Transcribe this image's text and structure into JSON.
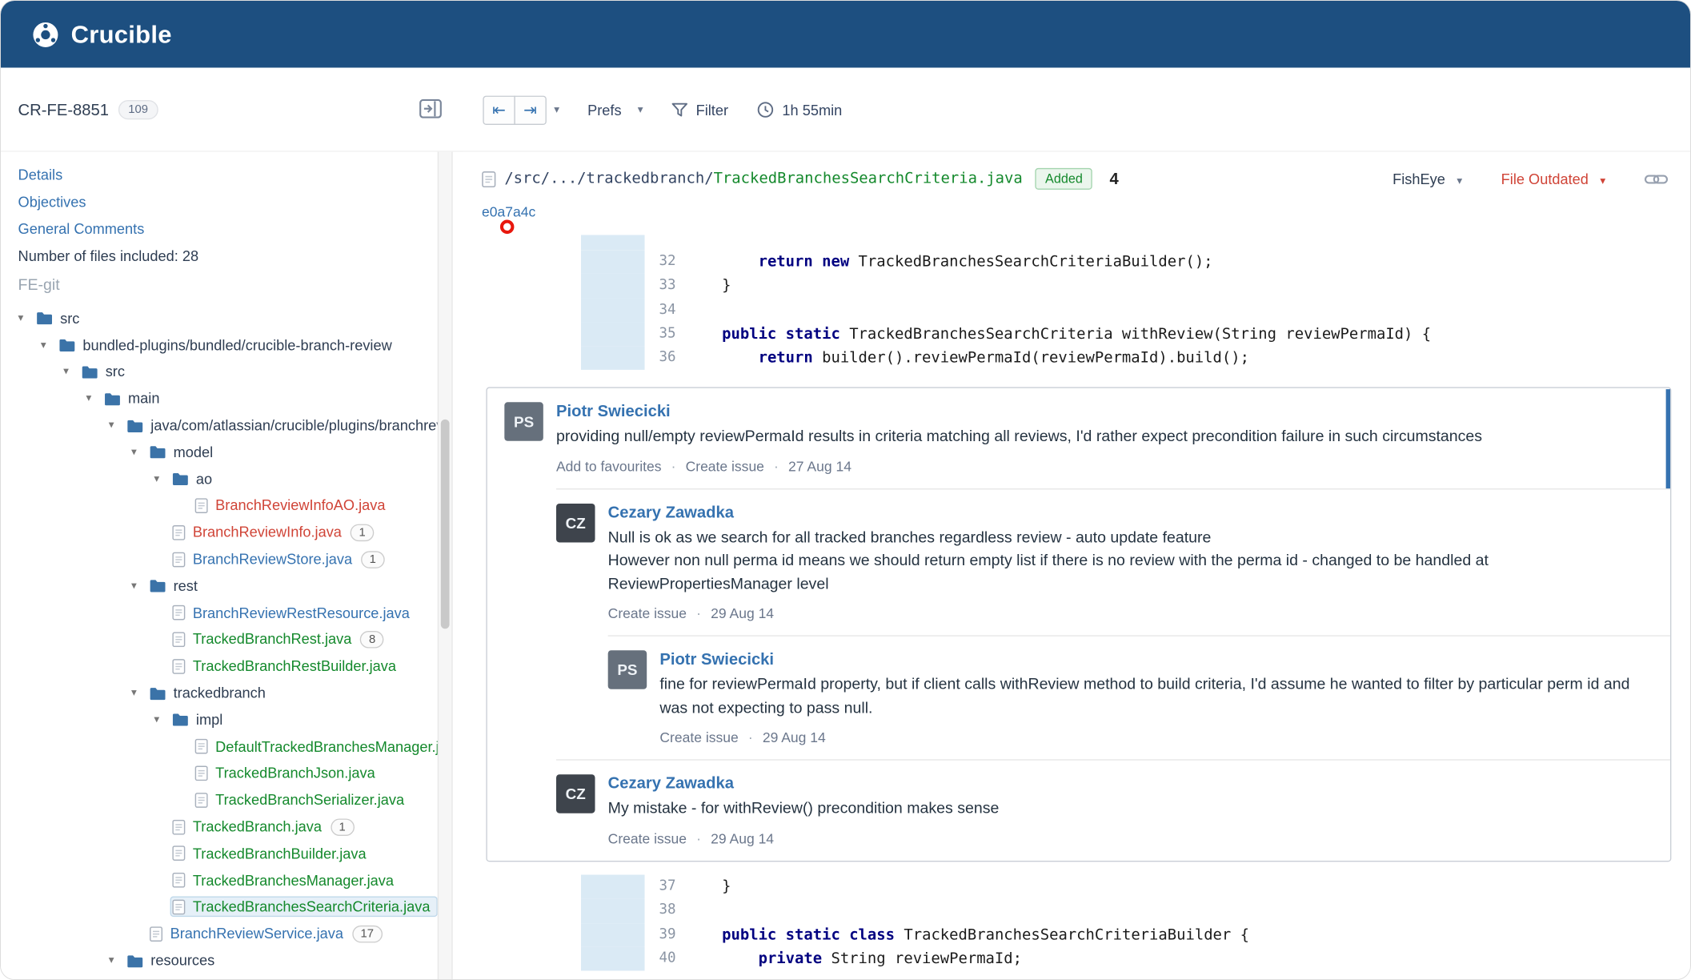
{
  "navbar": {
    "brand": "Crucible"
  },
  "colors": {
    "navbar": "#1d4f80",
    "accent_blue": "#3572b0",
    "added_green": "#14892c",
    "removed_red": "#d04437",
    "gutter_added": "#daeaf5",
    "keyword": "#000080"
  },
  "icons": {
    "prev_file": "⇤",
    "next_file": "⇥",
    "caret": "▾",
    "expanded_caret": "▾"
  },
  "misc": {
    "meta_separator": "·"
  },
  "left_panel": {
    "review_key": "CR-FE-8851",
    "review_count": "109",
    "links": [
      "Details",
      "Objectives",
      "General Comments"
    ],
    "files_included": "Number of files included: 28",
    "repo_label": "FE-git",
    "tree": [
      {
        "label": "src",
        "depth": 0,
        "kind": "folder"
      },
      {
        "label": "bundled-plugins/bundled/crucible-branch-review",
        "depth": 1,
        "kind": "folder"
      },
      {
        "label": "src",
        "depth": 2,
        "kind": "folder"
      },
      {
        "label": "main",
        "depth": 3,
        "kind": "folder"
      },
      {
        "label": "java/com/atlassian/crucible/plugins/branchreview",
        "depth": 4,
        "kind": "folder"
      },
      {
        "label": "model",
        "depth": 5,
        "kind": "folder"
      },
      {
        "label": "ao",
        "depth": 6,
        "kind": "folder"
      },
      {
        "label": "BranchReviewInfoAO.java",
        "depth": 7,
        "kind": "file",
        "color": "red"
      },
      {
        "label": "BranchReviewInfo.java",
        "depth": 6,
        "kind": "file",
        "color": "red",
        "badge": "1"
      },
      {
        "label": "BranchReviewStore.java",
        "depth": 6,
        "kind": "file",
        "color": "blue",
        "badge": "1"
      },
      {
        "label": "rest",
        "depth": 5,
        "kind": "folder"
      },
      {
        "label": "BranchReviewRestResource.java",
        "depth": 6,
        "kind": "file",
        "color": "blue"
      },
      {
        "label": "TrackedBranchRest.java",
        "depth": 6,
        "kind": "file",
        "color": "green",
        "badge": "8"
      },
      {
        "label": "TrackedBranchRestBuilder.java",
        "depth": 6,
        "kind": "file",
        "color": "green"
      },
      {
        "label": "trackedbranch",
        "depth": 5,
        "kind": "folder"
      },
      {
        "label": "impl",
        "depth": 6,
        "kind": "folder"
      },
      {
        "label": "DefaultTrackedBranchesManager.java",
        "depth": 7,
        "kind": "file",
        "color": "green"
      },
      {
        "label": "TrackedBranchJson.java",
        "depth": 7,
        "kind": "file",
        "color": "green"
      },
      {
        "label": "TrackedBranchSerializer.java",
        "depth": 7,
        "kind": "file",
        "color": "green"
      },
      {
        "label": "TrackedBranch.java",
        "depth": 6,
        "kind": "file",
        "color": "green",
        "badge": "1"
      },
      {
        "label": "TrackedBranchBuilder.java",
        "depth": 6,
        "kind": "file",
        "color": "green"
      },
      {
        "label": "TrackedBranchesManager.java",
        "depth": 6,
        "kind": "file",
        "color": "green"
      },
      {
        "label": "TrackedBranchesSearchCriteria.java",
        "depth": 6,
        "kind": "file",
        "color": "green",
        "selected": true
      },
      {
        "label": "BranchReviewService.java",
        "depth": 5,
        "kind": "file",
        "color": "blue",
        "badge": "17"
      },
      {
        "label": "resources",
        "depth": 4,
        "kind": "folder"
      }
    ]
  },
  "toolbar": {
    "prefs_label": "Prefs",
    "filter_label": "Filter",
    "time_label": "1h 55min"
  },
  "file_header": {
    "path_prefix": "/src/.../trackedbranch/",
    "file_name": "TrackedBranchesSearchCriteria.java",
    "status": "Added",
    "comment_count": "4",
    "fisheye_label": "FishEye",
    "outdated_label": "File Outdated",
    "revision": "e0a7a4c"
  },
  "code": {
    "blocks": [
      {
        "clipped_top": true,
        "lines": [
          {
            "no": "32",
            "parts": [
              {
                "t": "        "
              },
              {
                "t": "return",
                "k": 1
              },
              {
                "t": " "
              },
              {
                "t": "new",
                "k": 1
              },
              {
                "t": " TrackedBranchesSearchCriteriaBuilder();"
              }
            ]
          },
          {
            "no": "33",
            "parts": [
              {
                "t": "    }"
              }
            ]
          },
          {
            "no": "34",
            "parts": []
          },
          {
            "no": "35",
            "parts": [
              {
                "t": "    "
              },
              {
                "t": "public",
                "k": 1
              },
              {
                "t": " "
              },
              {
                "t": "static",
                "k": 1
              },
              {
                "t": " TrackedBranchesSearchCriteria withReview(String reviewPermaId) {"
              }
            ]
          },
          {
            "no": "36",
            "parts": [
              {
                "t": "        "
              },
              {
                "t": "return",
                "k": 1
              },
              {
                "t": " builder().reviewPermaId(reviewPermaId).build();"
              }
            ]
          }
        ]
      },
      {
        "clipped_top": false,
        "lines": [
          {
            "no": "37",
            "parts": [
              {
                "t": "    }"
              }
            ]
          },
          {
            "no": "38",
            "parts": []
          },
          {
            "no": "39",
            "parts": [
              {
                "t": "    "
              },
              {
                "t": "public",
                "k": 1
              },
              {
                "t": " "
              },
              {
                "t": "static",
                "k": 1
              },
              {
                "t": " "
              },
              {
                "t": "class",
                "k": 1
              },
              {
                "t": " TrackedBranchesSearchCriteriaBuilder {"
              }
            ]
          },
          {
            "no": "40",
            "parts": [
              {
                "t": "        "
              },
              {
                "t": "private",
                "k": 1
              },
              {
                "t": " String reviewPermaId;"
              }
            ]
          }
        ]
      }
    ]
  },
  "thread": [
    {
      "author": "Piotr Swiecicki",
      "initials": "PS",
      "avatar_bg": "#66707c",
      "depth": 0,
      "paragraphs": [
        "providing null/empty reviewPermaId results in criteria matching all reviews, I'd rather expect precondition failure in such circumstances"
      ],
      "actions": [
        "Add to favourites",
        "Create issue"
      ],
      "date": "27 Aug 14"
    },
    {
      "author": "Cezary Zawadka",
      "initials": "CZ",
      "avatar_bg": "#3e444c",
      "depth": 1,
      "paragraphs": [
        "Null is ok as we search for all tracked branches regardless review - auto update feature",
        "However non null perma id means we should return empty list if there is no review with the perma id - changed to be handled at ReviewPropertiesManager level"
      ],
      "actions": [
        "Create issue"
      ],
      "date": "29 Aug 14"
    },
    {
      "author": "Piotr Swiecicki",
      "initials": "PS",
      "avatar_bg": "#66707c",
      "depth": 2,
      "paragraphs": [
        "fine for reviewPermaId property, but if client calls withReview method to build criteria, I'd assume he wanted to filter by particular perm id and was not expecting to pass null."
      ],
      "actions": [
        "Create issue"
      ],
      "date": "29 Aug 14"
    },
    {
      "author": "Cezary Zawadka",
      "initials": "CZ",
      "avatar_bg": "#3e444c",
      "depth": 1,
      "paragraphs": [
        "My mistake - for withReview() precondition makes sense"
      ],
      "actions": [
        "Create issue"
      ],
      "date": "29 Aug 14"
    }
  ]
}
